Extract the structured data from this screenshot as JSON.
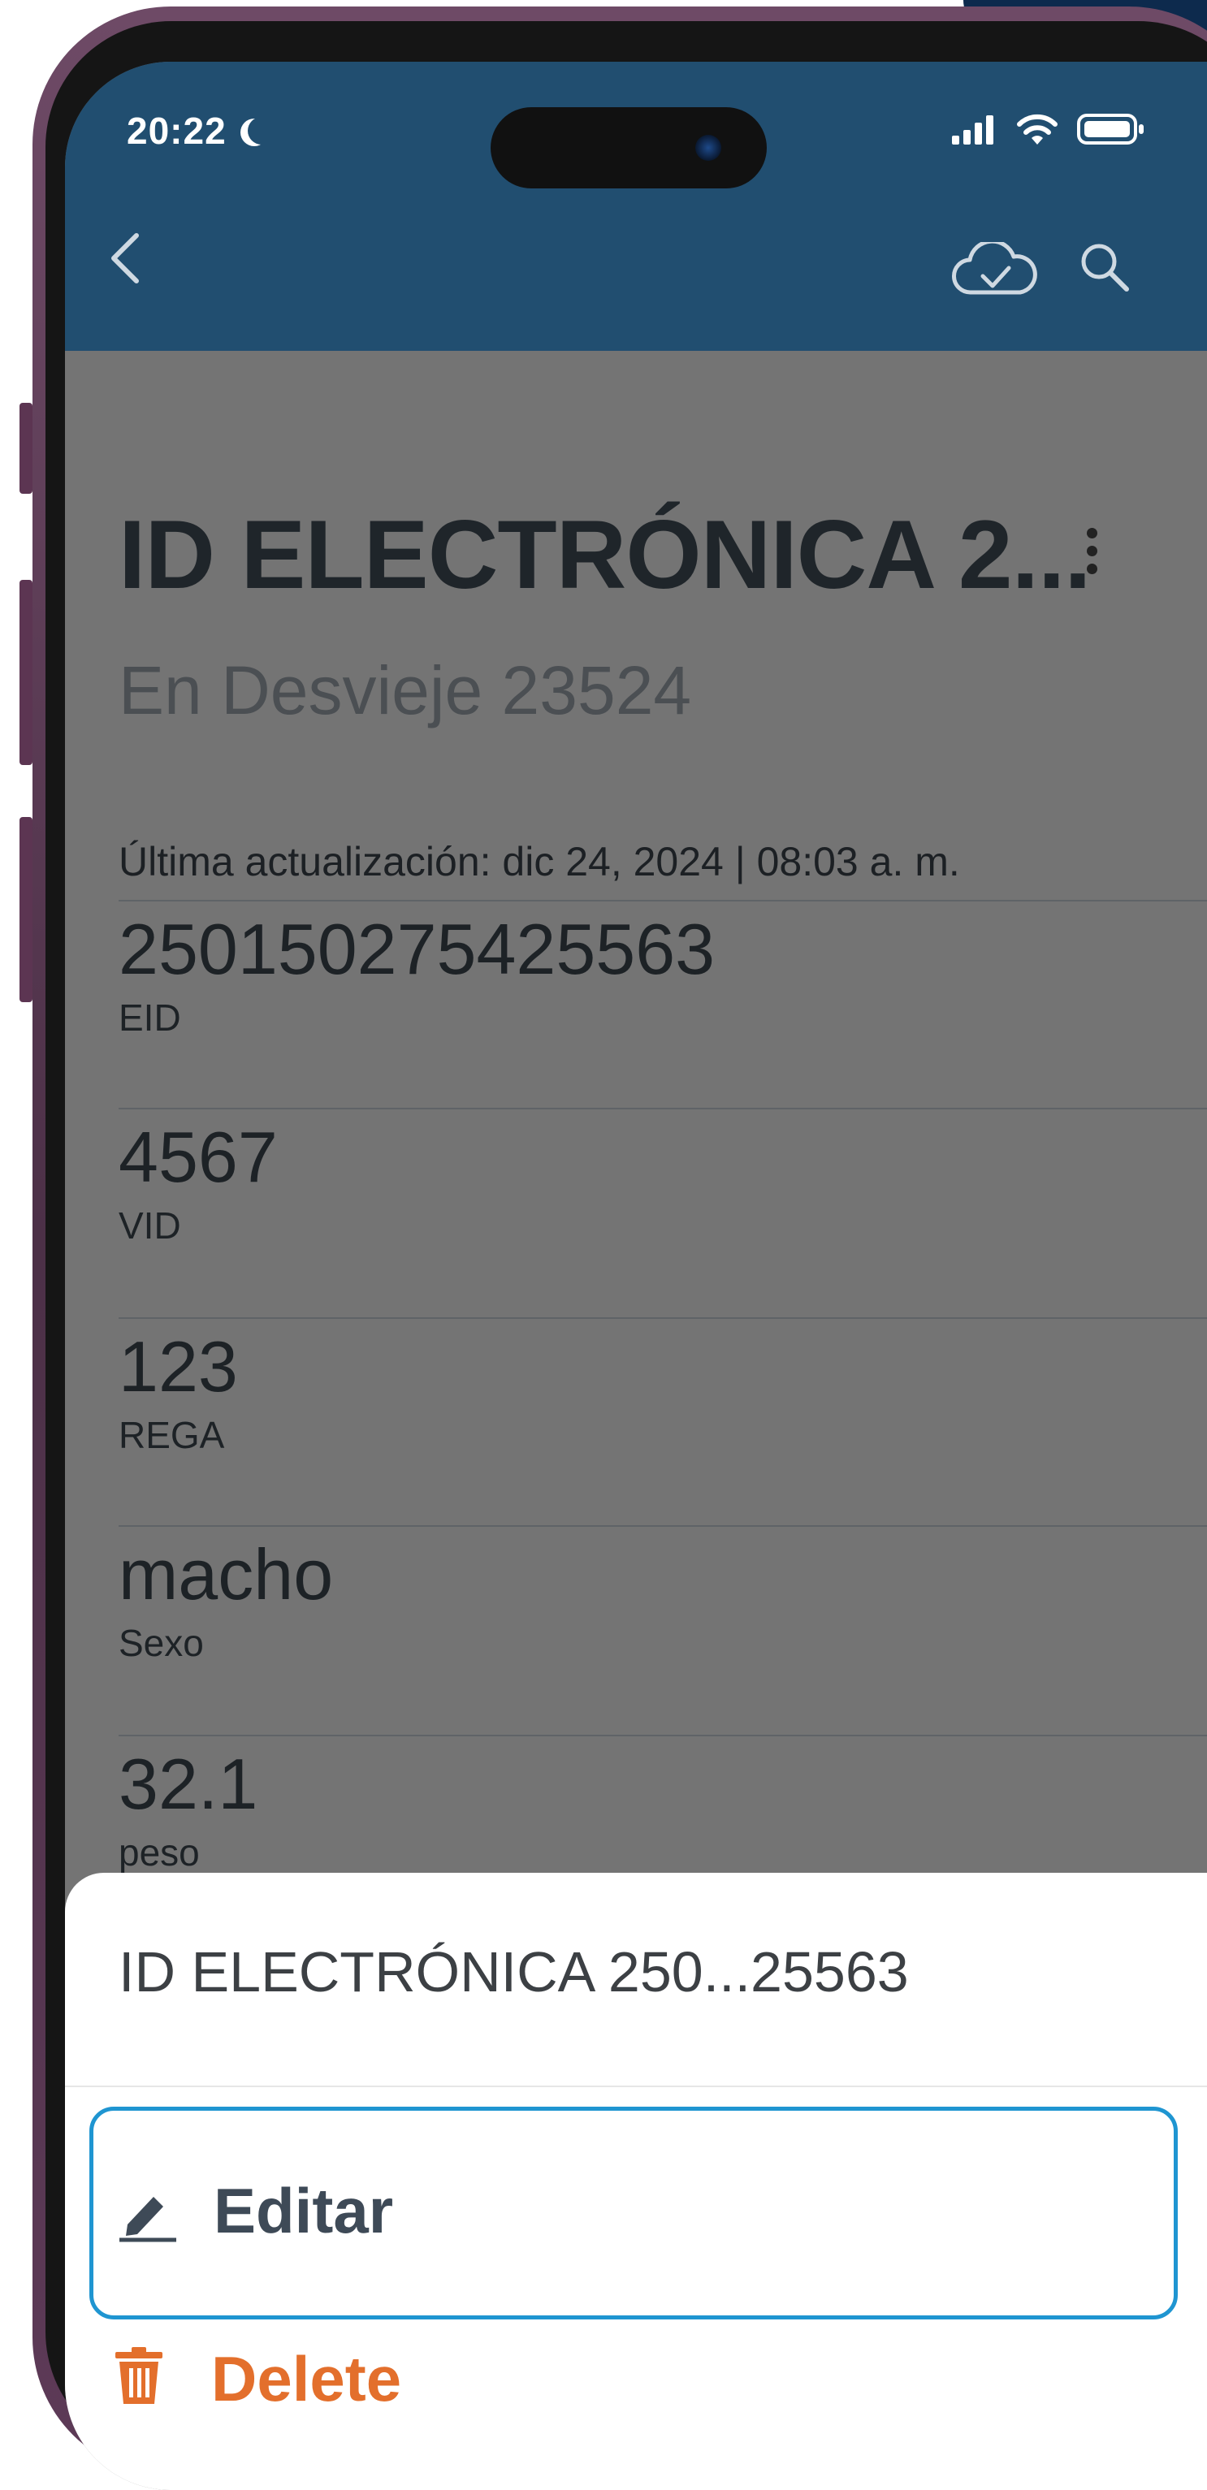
{
  "status_bar": {
    "time": "20:22",
    "icons": [
      "moon-icon",
      "signal-icon",
      "wifi-icon",
      "battery-icon"
    ]
  },
  "appbar": {
    "back_icon": "chevron-left-icon",
    "actions": [
      "cloud-sync-icon",
      "search-icon"
    ],
    "background": "#214e70"
  },
  "detail": {
    "title": "ID ELECTRÓNICA 2...",
    "subtitle": "En Desvieje 23524",
    "last_update": "Última actualización: dic 24, 2024 | 08:03 a. m.",
    "fields": [
      {
        "value": "250150275425563",
        "label": "EID"
      },
      {
        "value": "4567",
        "label": "VID"
      },
      {
        "value": "123",
        "label": "REGA"
      },
      {
        "value": "macho",
        "label": "Sexo"
      },
      {
        "value": "32.1",
        "label": "peso"
      }
    ]
  },
  "action_sheet": {
    "title": "ID ELECTRÓNICA 250...25563",
    "edit_label": "Editar",
    "delete_label": "Delete",
    "accent": "#1f95d1",
    "danger": "#e36f2c"
  }
}
